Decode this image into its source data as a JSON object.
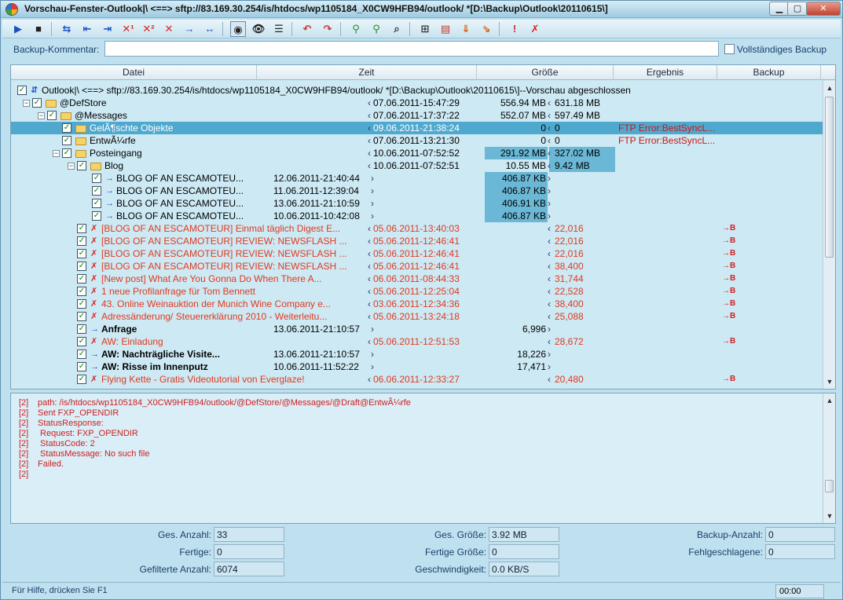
{
  "window": {
    "title": "Vorschau-Fenster-Outlook|\\ <==> sftp://83.169.30.254/is/htdocs/wp1105184_X0CW9HFB94/outlook/ *[D:\\Backup\\Outlook\\20110615\\]"
  },
  "toolbar": {
    "icons": [
      "play-icon",
      "stop-icon",
      "sync-icon",
      "copy-left-icon",
      "copy-right-icon",
      "delete-1-icon",
      "delete-2-icon",
      "delete-icon",
      "move-right-icon",
      "move-left-icon",
      "preview-icon",
      "eye-icon",
      "eye-list-icon",
      "undo-icon",
      "redo-icon",
      "filter-icon",
      "filter-plus-icon",
      "find-icon",
      "tree-icon",
      "select-all-icon",
      "arrow-down-icon",
      "arrow-down-right-icon",
      "alert-icon",
      "remove-icon"
    ]
  },
  "comment": {
    "label": "Backup-Kommentar:",
    "value": "",
    "full_backup_label": "Vollständiges Backup",
    "full_backup_checked": false
  },
  "columns": {
    "datei": "Datei",
    "zeit": "Zeit",
    "groesse": "Größe",
    "ergebnis": "Ergebnis",
    "backup": "Backup"
  },
  "rows": [
    {
      "name": "Outlook|\\ <==> sftp://83.169.30.254/is/htdocs/wp1105184_X0CW9HFB94/outlook/ *[D:\\Backup\\Outlook\\20110615\\]--Vorschau abgeschlossen",
      "date2": "",
      "time": "",
      "size1": "",
      "size2": "",
      "result": "",
      "backup": ""
    },
    {
      "name": "@DefStore",
      "date2": "",
      "time": "07.06.2011-15:47:29",
      "size1": "556.94 MB",
      "size2": "631.18 MB",
      "result": "",
      "backup": ""
    },
    {
      "name": "@Messages",
      "date2": "",
      "time": "07.06.2011-17:37:22",
      "size1": "552.07 MB",
      "size2": "597.49 MB",
      "result": "",
      "backup": ""
    },
    {
      "name": "GelÃ¶schte Objekte",
      "date2": "",
      "time": "09.06.2011-21:38:24",
      "size1": "0",
      "size2": "0",
      "result": "FTP Error:BestSyncL...",
      "backup": ""
    },
    {
      "name": "EntwÃ¼rfe",
      "date2": "",
      "time": "07.06.2011-13:21:30",
      "size1": "0",
      "size2": "0",
      "result": "FTP Error:BestSyncL...",
      "backup": ""
    },
    {
      "name": "Posteingang",
      "date2": "",
      "time": "10.06.2011-07:52:52",
      "size1": "291.92 MB",
      "size2": "327.02 MB",
      "result": "",
      "backup": ""
    },
    {
      "name": "Blog",
      "date2": "",
      "time": "10.06.2011-07:52:51",
      "size1": "10.55 MB",
      "size2": "9.42 MB",
      "result": "",
      "backup": ""
    },
    {
      "name": "BLOG OF AN ESCAMOTEU...",
      "date2": "12.06.2011-21:40:44",
      "time": "",
      "size1": "406.87 KB",
      "size2": "",
      "result": "",
      "backup": ""
    },
    {
      "name": "BLOG OF AN ESCAMOTEU...",
      "date2": "11.06.2011-12:39:04",
      "time": "",
      "size1": "406.87 KB",
      "size2": "",
      "result": "",
      "backup": ""
    },
    {
      "name": "BLOG OF AN ESCAMOTEU...",
      "date2": "13.06.2011-21:10:59",
      "time": "",
      "size1": "406.91 KB",
      "size2": "",
      "result": "",
      "backup": ""
    },
    {
      "name": "BLOG OF AN ESCAMOTEU...",
      "date2": "10.06.2011-10:42:08",
      "time": "",
      "size1": "406.87 KB",
      "size2": "",
      "result": "",
      "backup": ""
    },
    {
      "name": "[BLOG OF AN ESCAMOTEUR] Einmal täglich Digest E...",
      "date2": "",
      "time": "05.06.2011-13:40:03",
      "size1": "",
      "size2": "22,016",
      "result": "",
      "backup": "→B"
    },
    {
      "name": "[BLOG OF AN ESCAMOTEUR] REVIEW: NEWSFLASH ...",
      "date2": "",
      "time": "05.06.2011-12:46:41",
      "size1": "",
      "size2": "22,016",
      "result": "",
      "backup": "→B"
    },
    {
      "name": "[BLOG OF AN ESCAMOTEUR] REVIEW: NEWSFLASH ...",
      "date2": "",
      "time": "05.06.2011-12:46:41",
      "size1": "",
      "size2": "22,016",
      "result": "",
      "backup": "→B"
    },
    {
      "name": "[BLOG OF AN ESCAMOTEUR] REVIEW: NEWSFLASH ...",
      "date2": "",
      "time": "05.06.2011-12:46:41",
      "size1": "",
      "size2": "38,400",
      "result": "",
      "backup": "→B"
    },
    {
      "name": "[New post] What Are You Gonna Do When There A...",
      "date2": "",
      "time": "06.06.2011-08:44:33",
      "size1": "",
      "size2": "31,744",
      "result": "",
      "backup": "→B"
    },
    {
      "name": "1 neue Profilanfrage für Tom Bennett",
      "date2": "",
      "time": "05.06.2011-12:25:04",
      "size1": "",
      "size2": "22,528",
      "result": "",
      "backup": "→B"
    },
    {
      "name": "43. Online Weinauktion der Munich Wine Company e...",
      "date2": "",
      "time": "03.06.2011-12:34:36",
      "size1": "",
      "size2": "38,400",
      "result": "",
      "backup": "→B"
    },
    {
      "name": "Adressänderung/ Steuererklärung 2010 - Weiterleitu...",
      "date2": "",
      "time": "05.06.2011-13:24:18",
      "size1": "",
      "size2": "25,088",
      "result": "",
      "backup": "→B"
    },
    {
      "name": "Anfrage",
      "date2": "13.06.2011-21:10:57",
      "time": "",
      "size1": "6,996",
      "size2": "",
      "result": "",
      "backup": ""
    },
    {
      "name": "AW: Einladung",
      "date2": "",
      "time": "05.06.2011-12:51:53",
      "size1": "",
      "size2": "28,672",
      "result": "",
      "backup": "→B"
    },
    {
      "name": "AW: Nachträgliche Visite...",
      "date2": "13.06.2011-21:10:57",
      "time": "",
      "size1": "18,226",
      "size2": "",
      "result": "",
      "backup": ""
    },
    {
      "name": "AW: Risse im Innenputz",
      "date2": "10.06.2011-11:52:22",
      "time": "",
      "size1": "17,471",
      "size2": "",
      "result": "",
      "backup": ""
    },
    {
      "name": "Flying Kette - Gratis Videotutorial von Everglaze!",
      "date2": "",
      "time": "06.06.2011-12:33:27",
      "size1": "",
      "size2": "20,480",
      "result": "",
      "backup": "→B"
    }
  ],
  "log": {
    "lines": [
      {
        "n": "[2]",
        "text": "path: /is/htdocs/wp1105184_X0CW9HFB94/outlook/@DefStore/@Messages/@Draft@EntwÃ¼rfe"
      },
      {
        "n": "[2]",
        "text": "Sent FXP_OPENDIR"
      },
      {
        "n": "[2]",
        "text": "StatusResponse:"
      },
      {
        "n": "[2]",
        "text": "  Request: FXP_OPENDIR"
      },
      {
        "n": "[2]",
        "text": "  StatusCode: 2"
      },
      {
        "n": "[2]",
        "text": "  StatusMessage: No such file"
      },
      {
        "n": "[2]",
        "text": "Failed."
      },
      {
        "n": "[2]",
        "text": ""
      }
    ]
  },
  "stats": {
    "ges_anzahl_label": "Ges. Anzahl:",
    "ges_anzahl": "33",
    "fertige_label": "Fertige:",
    "fertige": "0",
    "gefilterte_label": "Gefilterte Anzahl:",
    "gefilterte": "6074",
    "ges_groesse_label": "Ges. Größe:",
    "ges_groesse": "3.92 MB",
    "fertige_groesse_label": "Fertige Größe:",
    "fertige_groesse": "0",
    "geschwindigkeit_label": "Geschwindigkeit:",
    "geschwindigkeit": "0.0 KB/S",
    "backup_anzahl_label": "Backup-Anzahl:",
    "backup_anzahl": "0",
    "fehlgeschlagene_label": "Fehlgeschlagene:",
    "fehlgeschlagene": "0"
  },
  "statusbar": {
    "help": "Für Hilfe, drücken Sie F1",
    "time": "00:00"
  }
}
